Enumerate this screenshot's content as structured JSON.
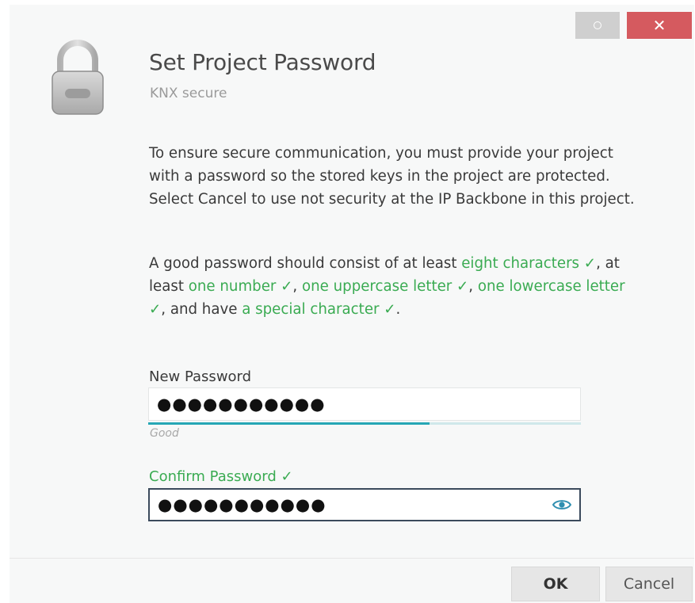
{
  "window": {
    "restore_icon": "circle-icon",
    "close_label": "✕"
  },
  "header": {
    "icon": "lock-icon",
    "title": "Set Project Password",
    "subtitle": "KNX secure"
  },
  "body": {
    "intro": "To ensure secure communication, you must provide your project with a password so the stored keys in the project are protected. Select Cancel to use not security at the IP Backbone in this project.",
    "rules": {
      "t1": "A good password should consist of at least ",
      "r1": "eight characters ✓",
      "t2": ", at least ",
      "r2": "one number ✓",
      "t3": ", ",
      "r3": "one uppercase letter ✓",
      "t4": ", ",
      "r4": "one lowercase letter ✓",
      "t5": ", and have ",
      "r5": "a special character ✓",
      "t6": "."
    },
    "rule_met_color": "#3aab52"
  },
  "new_password": {
    "label": "New Password",
    "value": "●●●●●●●●●●●",
    "strength_text": "Good",
    "strength_fraction": 0.65,
    "strength_color": "#26a7b5"
  },
  "confirm_password": {
    "label": "Confirm Password ✓",
    "value": "●●●●●●●●●●●",
    "reveal_icon": "eye-icon"
  },
  "footer": {
    "ok_label": "OK",
    "cancel_label": "Cancel"
  }
}
